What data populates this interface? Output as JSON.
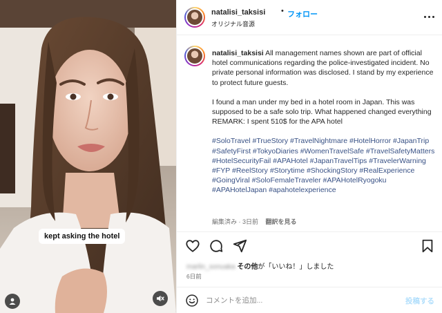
{
  "video": {
    "caption_overlay": "kept asking the hotel",
    "user_icon": "user-icon",
    "mute_icon": "speaker-muted-icon"
  },
  "header": {
    "username": "natalisi_taksisi",
    "separator": "•",
    "follow_label": "フォロー",
    "audio": "オリジナル音源",
    "more_icon": "more-options-icon"
  },
  "caption": {
    "username": "natalisi_taksisi",
    "paragraph1": "All management names shown are part of official hotel communications regarding the police-investigated incident. No private personal information was disclosed. I stand by my experience to protect future guests.",
    "paragraph2": "I found a man under my bed in a hotel room in Japan. This was supposed to be a safe solo trip. What happened changed everything",
    "remark": "REMARK: I spent 510$ for the APA hotel",
    "hashtags": "#SoloTravel #TrueStory #TravelNightmare #HotelHorror #JapanTrip #SafetyFirst #TokyoDiaries #WomenTravelSafe #TravelSafetyMatters #HotelSecurityFail #APAHotel #JapanTravelTips #TravelerWarning #FYP #ReelStory #Storytime #ShockingStory #RealExperience #GoingViral #SoloFemaleTraveler #APAHotelRyogoku #APAHotelJapan #apahotelexperience",
    "edited_meta": "編集済み · 3日前",
    "translate_label": "翻訳を見る"
  },
  "actions": {
    "like_icon": "heart-icon",
    "comment_icon": "comment-icon",
    "share_icon": "send-icon",
    "save_icon": "bookmark-icon"
  },
  "likes": {
    "liker_name": "marlin_sonuaka",
    "others_label": "その他",
    "suffix": "が「いいね！」しました"
  },
  "timestamp": "6日前",
  "comment_box": {
    "emoji_icon": "emoji-icon",
    "placeholder": "コメントを追加...",
    "post_label": "投稿する"
  },
  "colors": {
    "link_blue": "#0095f6",
    "hashtag_blue": "#385185",
    "muted_text": "#737373",
    "post_disabled": "#b2dffc"
  }
}
